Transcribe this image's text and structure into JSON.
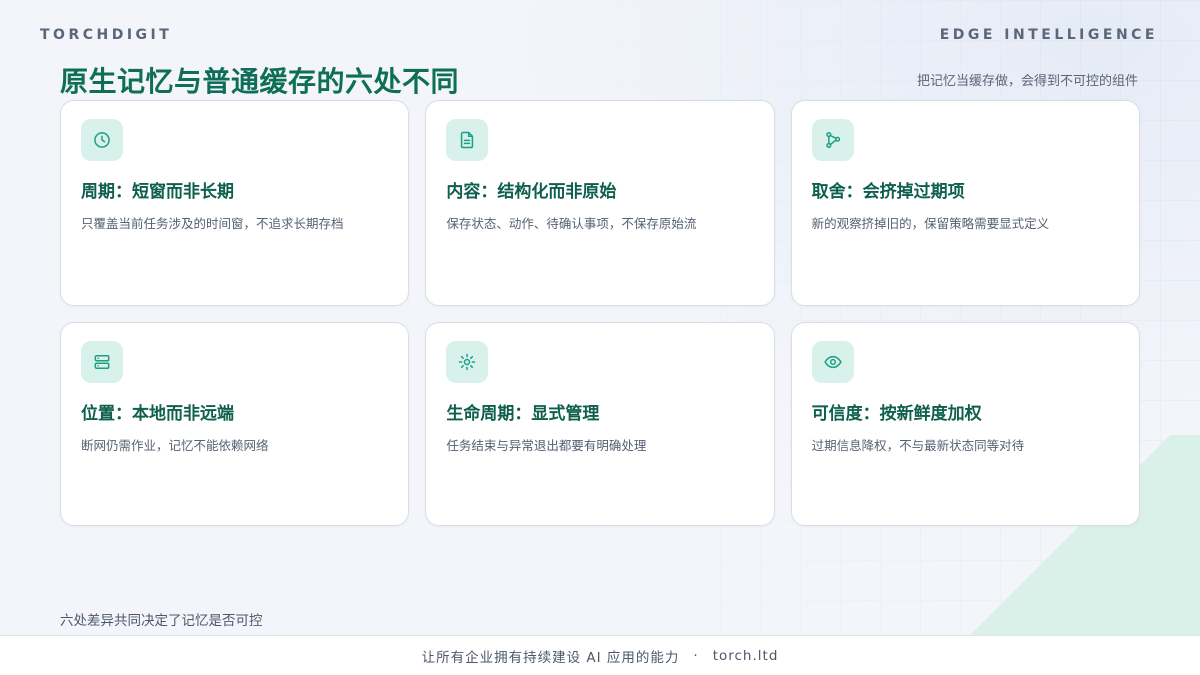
{
  "header": {
    "brand": "TORCHDIGIT",
    "tagline": "EDGE INTELLIGENCE"
  },
  "title": "原生记忆与普通缓存的六处不同",
  "subtitle": "把记忆当缓存做，会得到不可控的组件",
  "cards": [
    {
      "icon": "clock-icon",
      "title": "周期：短窗而非长期",
      "desc": "只覆盖当前任务涉及的时间窗，不追求长期存档"
    },
    {
      "icon": "document-icon",
      "title": "内容：结构化而非原始",
      "desc": "保存状态、动作、待确认事项，不保存原始流"
    },
    {
      "icon": "branch-icon",
      "title": "取舍：会挤掉过期项",
      "desc": "新的观察挤掉旧的，保留策略需要显式定义"
    },
    {
      "icon": "server-icon",
      "title": "位置：本地而非远端",
      "desc": "断网仍需作业，记忆不能依赖网络"
    },
    {
      "icon": "sun-icon",
      "title": "生命周期：显式管理",
      "desc": "任务结束与异常退出都要有明确处理"
    },
    {
      "icon": "eye-icon",
      "title": "可信度：按新鲜度加权",
      "desc": "过期信息降权，不与最新状态同等对待"
    }
  ],
  "summary": "六处差异共同决定了记忆是否可控",
  "footer": {
    "text": "让所有企业拥有持续建设 AI 应用的能力",
    "separator": "·",
    "site": "torch.ltd"
  },
  "colors": {
    "accent": "#0e6e58",
    "icon_bg": "#d8f1ea",
    "icon_stroke": "#1aa085"
  }
}
